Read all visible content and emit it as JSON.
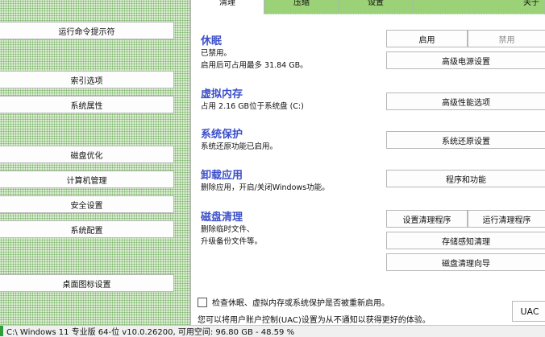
{
  "left_buttons": [
    {
      "label": "运行命令提示符"
    },
    {
      "label": "索引选项"
    },
    {
      "label": "系统属性"
    },
    {
      "label": "磁盘优化"
    },
    {
      "label": "计算机管理"
    },
    {
      "label": "安全设置"
    },
    {
      "label": "系统配置"
    },
    {
      "label": "桌面图标设置"
    }
  ],
  "tabs": [
    {
      "label": "清理",
      "active": true
    },
    {
      "label": "压缩",
      "active": false
    },
    {
      "label": "设置",
      "active": false
    },
    {
      "label": "关于",
      "active": false
    }
  ],
  "sections": {
    "hibernate": {
      "title": "休眠",
      "line1": "已禁用。",
      "line2": "启用后可占用最多 31.84 GB。",
      "enable": "启用",
      "disable": "禁用",
      "advanced": "高级电源设置"
    },
    "virtual_memory": {
      "title": "虚拟内存",
      "line1": "占用 2.16 GB位于系统盘 (C:)",
      "advanced": "高级性能选项"
    },
    "system_protection": {
      "title": "系统保护",
      "line1": "系统还原功能已启用。",
      "button": "系统还原设置"
    },
    "uninstall": {
      "title": "卸载应用",
      "line1": "删除应用，开启/关闭Windows功能。",
      "button": "程序和功能"
    },
    "disk_cleanup": {
      "title": "磁盘清理",
      "line1": "删除临时文件、",
      "line2": "升级备份文件等。",
      "setup": "设置清理程序",
      "run": "运行清理程序",
      "storage_sense": "存储感知清理",
      "wizard": "磁盘清理向导"
    }
  },
  "footer": {
    "checkbox_label": "检查休眠、虚拟内存或系统保护是否被重新启用。",
    "checkbox_checked": false,
    "note": "您可以将用户账户控制(UAC)设置为从不通知以获得更好的体验。",
    "uac_button": "UAC"
  },
  "status_bar": {
    "text": "C:\\ Windows 11 专业版 64-位 v10.0.26200,  可用空间: 96.80 GB - 48.59 %"
  },
  "colors": {
    "accent_blue": "#3b4fc9",
    "panel_green": "#d9ecd0",
    "tab_green": "#9bd177",
    "status_green": "#2e9e3a"
  }
}
